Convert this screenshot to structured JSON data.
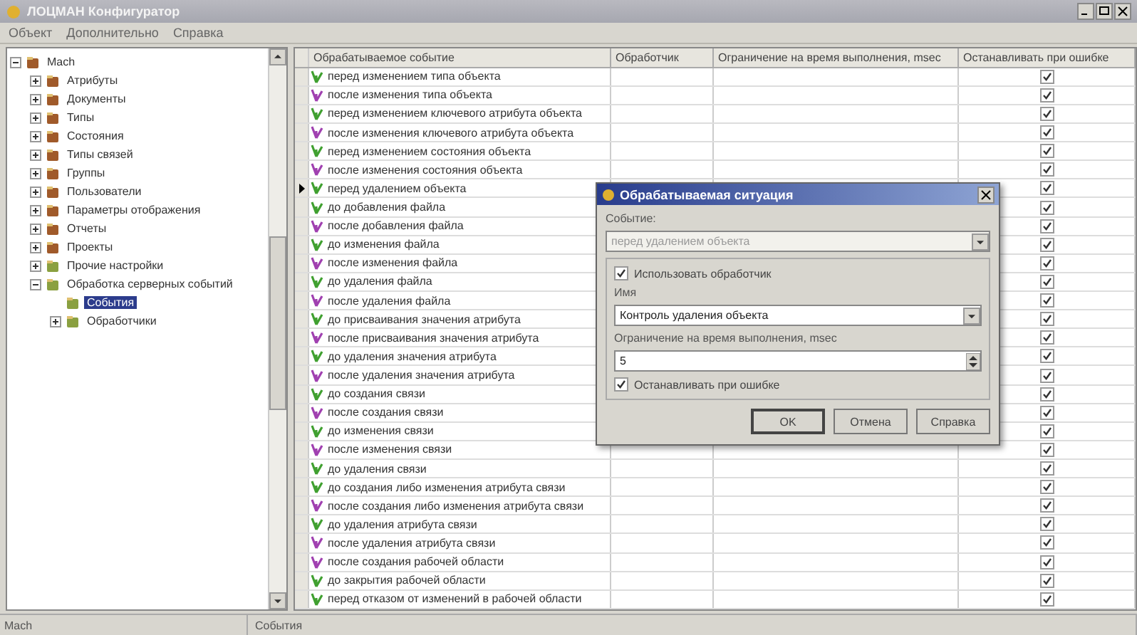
{
  "window": {
    "title": "ЛОЦМАН Конфигуратор"
  },
  "menu": [
    "Объект",
    "Дополнительно",
    "Справка"
  ],
  "tree": {
    "label": "Mach",
    "expanded": true,
    "children": [
      {
        "label": "Атрибуты",
        "expanded": false
      },
      {
        "label": "Документы",
        "expanded": false
      },
      {
        "label": "Типы",
        "expanded": false
      },
      {
        "label": "Состояния",
        "expanded": false
      },
      {
        "label": "Типы связей",
        "expanded": false
      },
      {
        "label": "Группы",
        "expanded": false
      },
      {
        "label": "Пользователи",
        "expanded": false
      },
      {
        "label": "Параметры отображения",
        "expanded": false
      },
      {
        "label": "Отчеты",
        "expanded": false
      },
      {
        "label": "Проекты",
        "expanded": false
      },
      {
        "label": "Прочие настройки",
        "expanded": false
      },
      {
        "label": "Обработка серверных событий",
        "expanded": true,
        "children": [
          {
            "label": "События",
            "selected": true
          },
          {
            "label": "Обработчики",
            "selected": false,
            "expanded": false
          }
        ]
      }
    ]
  },
  "table": {
    "columns": [
      "Обрабатываемое событие",
      "Обработчик",
      "Ограничение на время выполнения, msec",
      "Останавливать при ошибке"
    ],
    "rows": [
      {
        "event": "перед изменением типа объекта",
        "kind": "before",
        "stop_on_error": true,
        "selected": false
      },
      {
        "event": "после изменения типа объекта",
        "kind": "after",
        "stop_on_error": true,
        "selected": false
      },
      {
        "event": "перед изменением ключевого атрибута объекта",
        "kind": "before",
        "stop_on_error": true,
        "selected": false
      },
      {
        "event": "после изменения ключевого атрибута объекта",
        "kind": "after",
        "stop_on_error": true,
        "selected": false
      },
      {
        "event": "перед изменением состояния объекта",
        "kind": "before",
        "stop_on_error": true,
        "selected": false
      },
      {
        "event": "после изменения состояния объекта",
        "kind": "after",
        "stop_on_error": true,
        "selected": false
      },
      {
        "event": "перед удалением объекта",
        "kind": "before",
        "stop_on_error": true,
        "selected": true
      },
      {
        "event": "до добавления файла",
        "kind": "before",
        "stop_on_error": true,
        "selected": false
      },
      {
        "event": "после добавления файла",
        "kind": "after",
        "stop_on_error": true,
        "selected": false
      },
      {
        "event": "до изменения файла",
        "kind": "before",
        "stop_on_error": true,
        "selected": false
      },
      {
        "event": "после изменения файла",
        "kind": "after",
        "stop_on_error": true,
        "selected": false
      },
      {
        "event": "до удаления файла",
        "kind": "before",
        "stop_on_error": true,
        "selected": false
      },
      {
        "event": "после удаления файла",
        "kind": "after",
        "stop_on_error": true,
        "selected": false
      },
      {
        "event": "до присваивания значения атрибута",
        "kind": "before",
        "stop_on_error": true,
        "selected": false
      },
      {
        "event": "после присваивания значения атрибута",
        "kind": "after",
        "stop_on_error": true,
        "selected": false
      },
      {
        "event": "до удаления значения атрибута",
        "kind": "before",
        "stop_on_error": true,
        "selected": false
      },
      {
        "event": "после удаления значения атрибута",
        "kind": "after",
        "stop_on_error": true,
        "selected": false
      },
      {
        "event": "до создания связи",
        "kind": "before",
        "stop_on_error": true,
        "selected": false
      },
      {
        "event": "после создания связи",
        "kind": "after",
        "stop_on_error": true,
        "selected": false
      },
      {
        "event": "до изменения связи",
        "kind": "before",
        "stop_on_error": true,
        "selected": false
      },
      {
        "event": "после изменения связи",
        "kind": "after",
        "stop_on_error": true,
        "selected": false
      },
      {
        "event": "до удаления связи",
        "kind": "before",
        "stop_on_error": true,
        "selected": false
      },
      {
        "event": "до создания либо изменения атрибута связи",
        "kind": "before",
        "stop_on_error": true,
        "selected": false
      },
      {
        "event": "после создания либо изменения атрибута связи",
        "kind": "after",
        "stop_on_error": true,
        "selected": false
      },
      {
        "event": "до удаления атрибута связи",
        "kind": "before",
        "stop_on_error": true,
        "selected": false
      },
      {
        "event": "после удаления атрибута связи",
        "kind": "after",
        "stop_on_error": true,
        "selected": false
      },
      {
        "event": "после создания рабочей области",
        "kind": "after",
        "stop_on_error": true,
        "selected": false
      },
      {
        "event": "до закрытия рабочей области",
        "kind": "before",
        "stop_on_error": true,
        "selected": false
      },
      {
        "event": "перед отказом от изменений в рабочей области",
        "kind": "before",
        "stop_on_error": true,
        "selected": false
      }
    ]
  },
  "dialog": {
    "title": "Обрабатываемая ситуация",
    "event_label": "Событие:",
    "event": {
      "value": "перед удалением объекта",
      "disabled": true
    },
    "use_handler": {
      "label": "Использовать обработчик",
      "checked": true
    },
    "name_label": "Имя",
    "name": {
      "value": "Контроль удаления объекта"
    },
    "limit_label": "Ограничение на время выполнения, msec",
    "limit": {
      "value": "5"
    },
    "stop": {
      "label": "Останавливать при ошибке",
      "checked": true
    },
    "buttons": [
      {
        "label": "OK",
        "default": true
      },
      {
        "label": "Отмена",
        "default": false
      },
      {
        "label": "Справка",
        "default": false
      }
    ]
  },
  "status_bar": [
    "Mach",
    "События"
  ]
}
